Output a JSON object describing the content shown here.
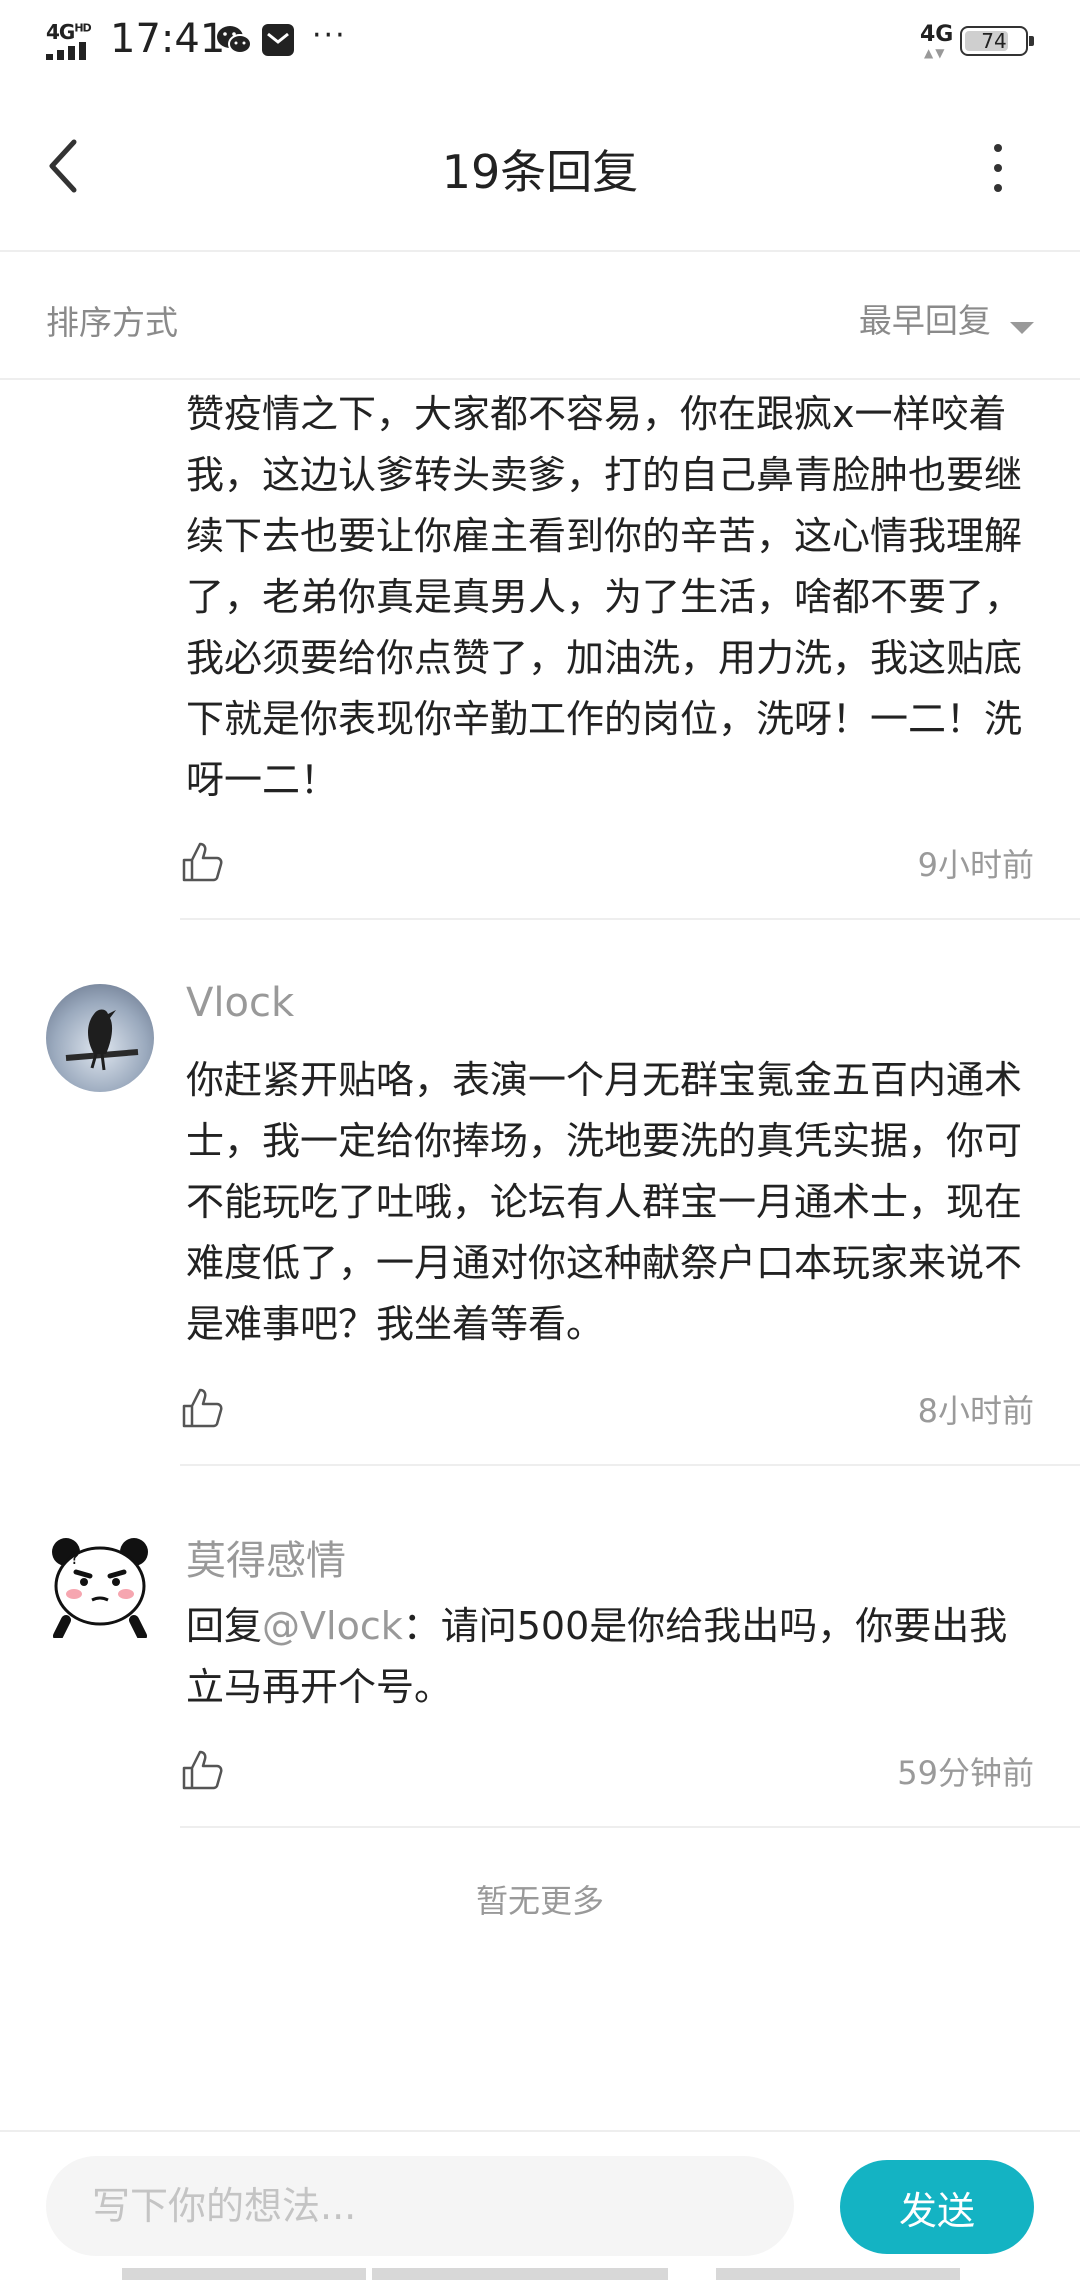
{
  "status_bar": {
    "network": "4G",
    "network_hd": "HD",
    "time": "17:41",
    "more": "···",
    "signal_type": "4G",
    "battery": "74",
    "battery_level": 0.74,
    "icons": [
      "signal-icon",
      "wechat-icon",
      "mail-icon",
      "more-dots-icon",
      "battery-icon"
    ]
  },
  "header": {
    "title": "19条回复",
    "back_icon": "chevron-left-icon",
    "more_icon": "vertical-dots-icon"
  },
  "sort": {
    "label": "排序方式",
    "value": "最早回复"
  },
  "comments": [
    {
      "body": "赞疫情之下，大家都不容易，你在跟疯x一样咬着我，这边认爹转头卖爹，打的自己鼻青脸肿也要继续下去也要让你雇主看到你的辛苦，这心情我理解了，老弟你真是真男人，为了生活，啥都不要了，我必须要给你点赞了，加油洗，用力洗，我这贴底下就是你表现你辛勤工作的岗位，洗呀！一二！洗呀一二！",
      "time": "9小时前"
    },
    {
      "user": "Vlock",
      "body": "你赶紧开贴咯，表演一个月无群宝氪金五百内通术士，我一定给你捧场，洗地要洗的真凭实据，你可不能玩吃了吐哦，论坛有人群宝一月通术士，现在难度低了，一月通对你这种献祭户口本玩家来说不是难事吧？我坐着等看。",
      "time": "8小时前"
    },
    {
      "user": "莫得感情",
      "reply_prefix": "回复",
      "mention": "@Vlock",
      "reply_text": "：请问500是你给我出吗，你要出我立马再开个号。",
      "time": "59分钟前"
    }
  ],
  "footer_text": "暂无更多",
  "input": {
    "placeholder": "写下你的想法...",
    "value": ""
  },
  "send_label": "发送",
  "colors": {
    "accent": "#14b3c3",
    "secondary_text": "#999999",
    "divider": "#eeeeee"
  }
}
